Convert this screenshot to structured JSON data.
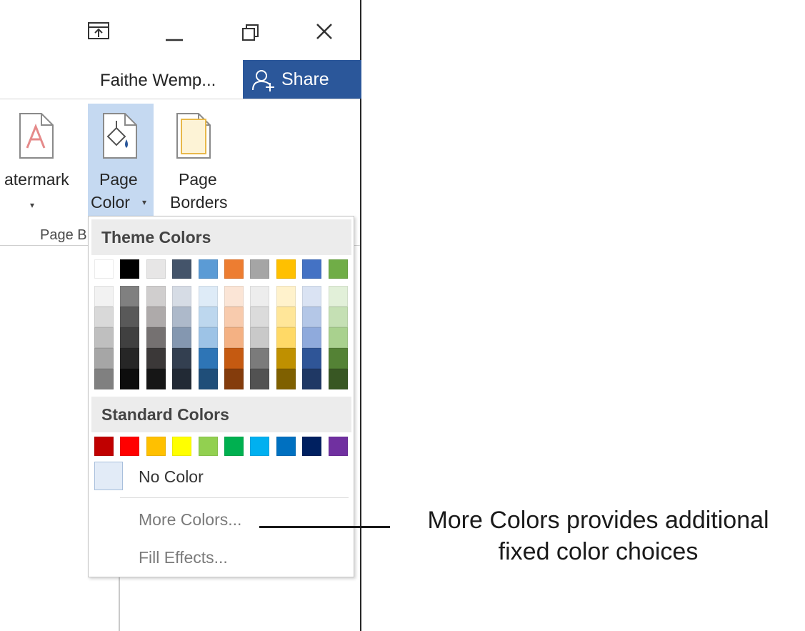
{
  "window": {
    "user_name": "Faithe Wemp...",
    "share_label": "Share",
    "accent_color": "#2b579a"
  },
  "ribbon": {
    "watermark": {
      "label": "atermark",
      "icon": "watermark-icon"
    },
    "page_color": {
      "line1": "Page",
      "line2": "Color",
      "icon": "page-color-icon",
      "selected": true
    },
    "page_borders": {
      "line1": "Page",
      "line2": "Borders",
      "icon": "page-borders-icon"
    },
    "group_label": "Page B"
  },
  "dropdown": {
    "theme_header": "Theme Colors",
    "standard_header": "Standard Colors",
    "no_color": "No Color",
    "more_colors": "More Colors...",
    "fill_effects": "Fill Effects...",
    "theme_top_row": [
      "#ffffff",
      "#000000",
      "#e7e6e6",
      "#44546a",
      "#5b9bd5",
      "#ed7d31",
      "#a5a5a5",
      "#ffc000",
      "#4472c4",
      "#70ad47"
    ],
    "theme_shades": [
      [
        "#f2f2f2",
        "#d9d9d9",
        "#bfbfbf",
        "#a6a6a6",
        "#808080"
      ],
      [
        "#808080",
        "#595959",
        "#404040",
        "#262626",
        "#0d0d0d"
      ],
      [
        "#d0cece",
        "#aeaaaa",
        "#757171",
        "#3b3838",
        "#161616"
      ],
      [
        "#d6dce5",
        "#adb9ca",
        "#8497b0",
        "#333f50",
        "#222a35"
      ],
      [
        "#deebf7",
        "#bdd7ee",
        "#9dc3e6",
        "#2e75b6",
        "#1f4e79"
      ],
      [
        "#fbe5d6",
        "#f8cbad",
        "#f4b183",
        "#c55a11",
        "#843c0c"
      ],
      [
        "#ededed",
        "#dbdbdb",
        "#c9c9c9",
        "#7b7b7b",
        "#525252"
      ],
      [
        "#fff2cc",
        "#ffe699",
        "#ffd966",
        "#bf9000",
        "#7f6000"
      ],
      [
        "#dae3f3",
        "#b4c7e7",
        "#8faadc",
        "#2f5597",
        "#1f3864"
      ],
      [
        "#e2f0d9",
        "#c5e0b4",
        "#a9d18e",
        "#548235",
        "#385723"
      ]
    ],
    "standard_colors": [
      "#c00000",
      "#ff0000",
      "#ffc000",
      "#ffff00",
      "#92d050",
      "#00b050",
      "#00b0f0",
      "#0070c0",
      "#002060",
      "#7030a0"
    ]
  },
  "callout": {
    "line1": "More Colors provides additional",
    "line2": "fixed color choices"
  }
}
